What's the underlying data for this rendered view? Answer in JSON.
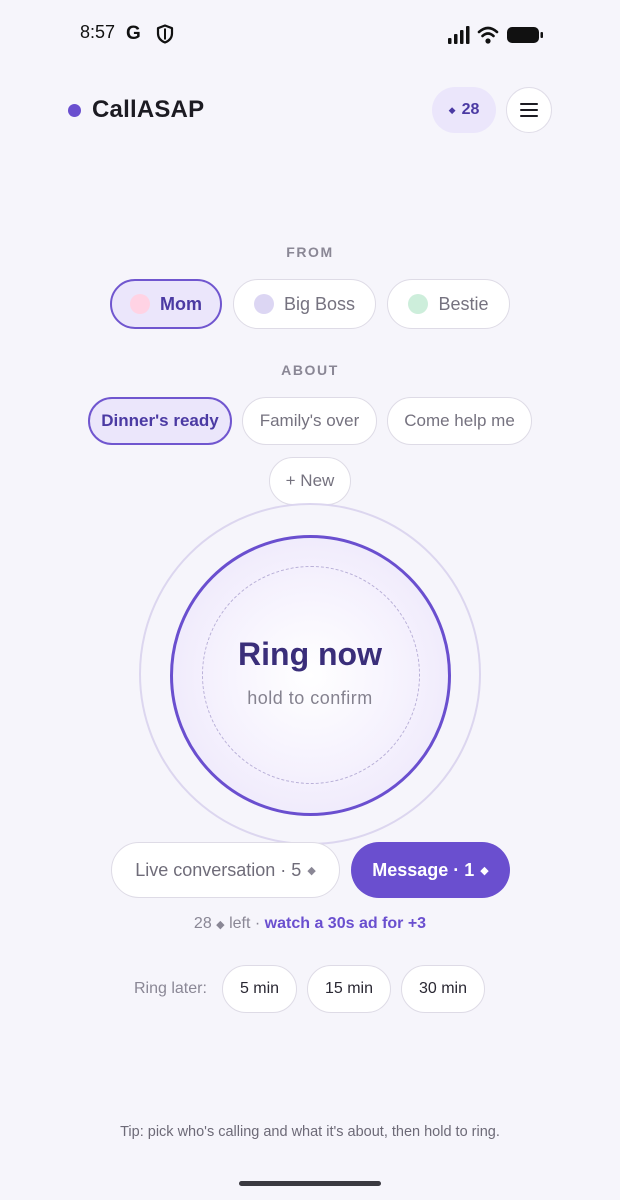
{
  "status_bar": {
    "time": "8:57",
    "g_glyph": "G"
  },
  "header": {
    "app_name": "CallASAP",
    "credits": "28",
    "accent_color": "#6a4fcf"
  },
  "from": {
    "label": "FROM",
    "callers": [
      {
        "name": "Mom",
        "color": "#ffd3e4",
        "selected": true
      },
      {
        "name": "Big Boss",
        "color": "#dcd6f3",
        "selected": false
      },
      {
        "name": "Bestie",
        "color": "#cdeedb",
        "selected": false
      }
    ]
  },
  "about": {
    "label": "ABOUT",
    "topics": [
      {
        "name": "Dinner's ready",
        "selected": true
      },
      {
        "name": "Family's over",
        "selected": false
      },
      {
        "name": "Come help me",
        "selected": false
      }
    ],
    "new_label": "+ New"
  },
  "ring": {
    "title": "Ring now",
    "subtitle": "hold to confirm"
  },
  "modes": {
    "live": {
      "label": "Live conversation · 5",
      "selected": false
    },
    "message": {
      "label": "Message · 1",
      "selected": true
    }
  },
  "credits_line": {
    "count": "28",
    "left_text": "left ·",
    "ad_link": "watch a 30s ad for +3"
  },
  "ring_later": {
    "label": "Ring later:",
    "options": [
      "5 min",
      "15 min",
      "30 min"
    ]
  },
  "tip": "Tip: pick who's calling and what it's about, then hold to ring."
}
